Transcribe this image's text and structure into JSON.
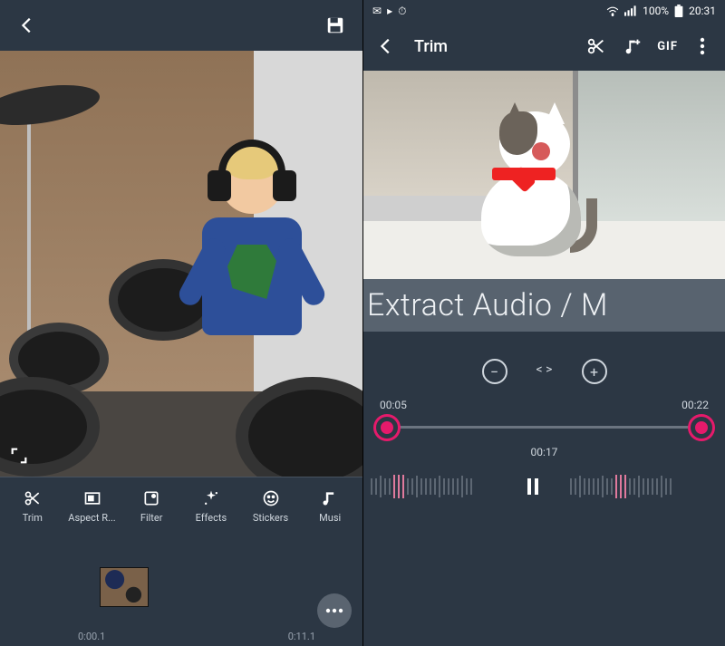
{
  "left": {
    "toolbar": {
      "back": "back",
      "save": "save"
    },
    "tools": [
      {
        "name": "trim",
        "label": "Trim"
      },
      {
        "name": "aspect",
        "label": "Aspect R..."
      },
      {
        "name": "filter",
        "label": "Filter"
      },
      {
        "name": "effects",
        "label": "Effects"
      },
      {
        "name": "stickers",
        "label": "Stickers"
      },
      {
        "name": "music",
        "label": "Musi"
      }
    ],
    "timeline": {
      "start": "0:00.1",
      "end": "0:11.1"
    }
  },
  "right": {
    "status": {
      "battery_pct": "100%",
      "clock": "20:31"
    },
    "appbar": {
      "title": "Trim",
      "gif_label": "GIF"
    },
    "caption": "Extract Audio / M",
    "trim": {
      "start": "00:05",
      "end": "00:22",
      "current": "00:17"
    },
    "zoom": {
      "out": "−",
      "in": "+",
      "fit": "< >"
    }
  }
}
